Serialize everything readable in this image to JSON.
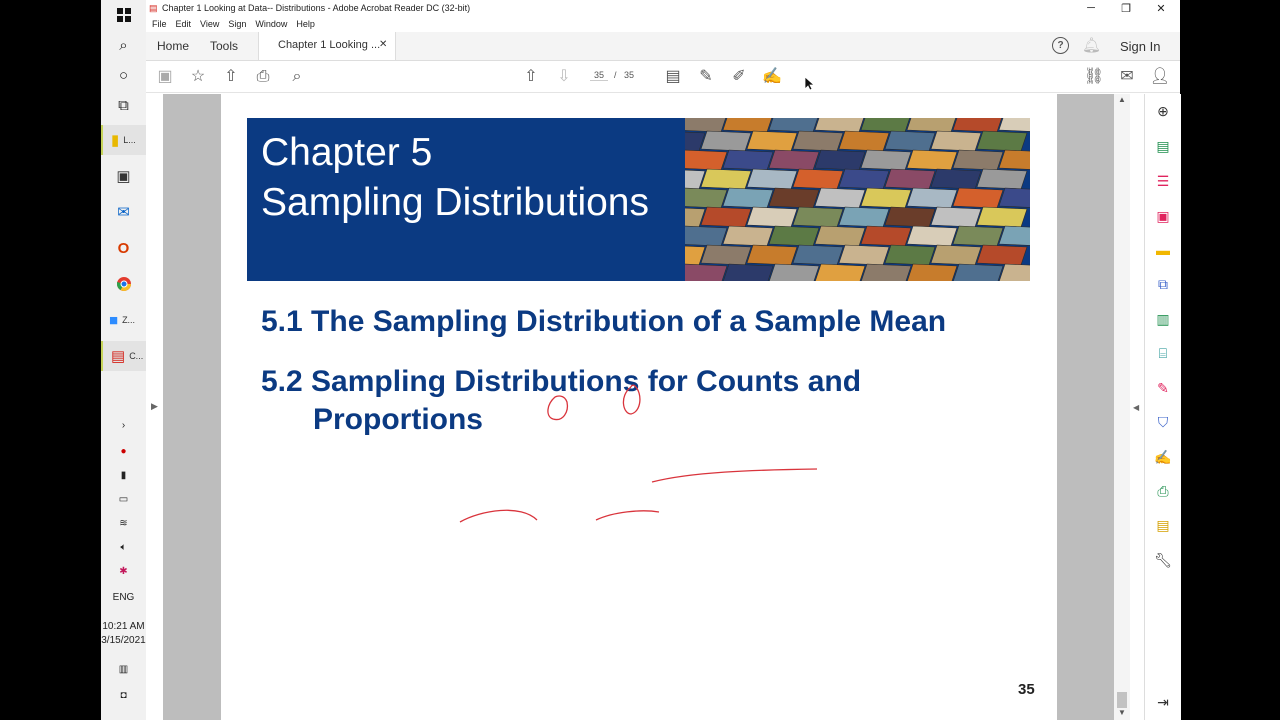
{
  "taskbar": {
    "clock_time": "10:21 AM",
    "clock_date": "3/15/2021",
    "language": "ENG",
    "apps": [
      {
        "label": "L..."
      },
      {
        "label": "Z..."
      },
      {
        "label": "C..."
      }
    ]
  },
  "window": {
    "title": "Chapter 1 Looking at Data-- Distributions - Adobe Acrobat Reader DC (32-bit)",
    "menu": [
      "File",
      "Edit",
      "View",
      "Sign",
      "Window",
      "Help"
    ]
  },
  "tabs": {
    "home": "Home",
    "tools": "Tools",
    "document": "Chapter 1 Looking ...",
    "sign_in": "Sign In"
  },
  "toolbar": {
    "page_current": "35",
    "page_separator": "/",
    "page_total": "35"
  },
  "slide": {
    "title_line1": "Chapter 5",
    "title_line2": "Sampling Distributions",
    "section1": "5.1 The Sampling Distribution of a Sample Mean",
    "section2_line1": "5.2 Sampling Distributions for Counts and",
    "section2_line2": "Proportions",
    "page_number": "35"
  },
  "colors": {
    "banner": "#0b3a82",
    "heading": "#0b3a82",
    "annotation": "#d9343c"
  }
}
